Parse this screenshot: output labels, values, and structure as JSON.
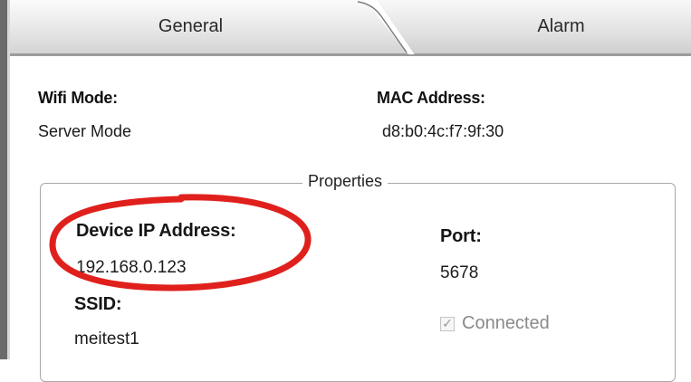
{
  "tabs": [
    {
      "label": "General"
    },
    {
      "label": "Alarm"
    }
  ],
  "general": {
    "wifi_mode_label": "Wifi Mode:",
    "wifi_mode_value": "Server Mode",
    "mac_label": "MAC Address:",
    "mac_value": "d8:b0:4c:f7:9f:30"
  },
  "properties": {
    "title": "Properties",
    "ip_label": "Device IP Address:",
    "ip_value": "192.168.0.123",
    "port_label": "Port:",
    "port_value": "5678",
    "ssid_label": "SSID:",
    "ssid_value": "meitest1",
    "connected_label": "Connected",
    "connected_checked": true
  },
  "colors": {
    "highlight_circle": "#e0201c"
  }
}
